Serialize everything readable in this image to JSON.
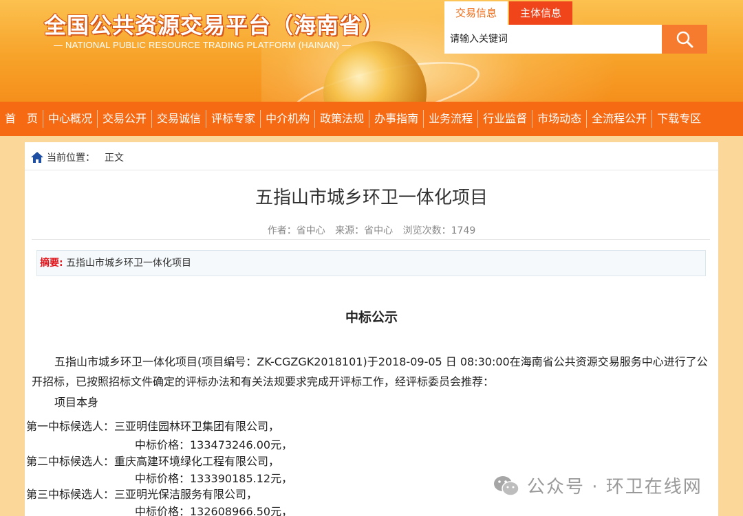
{
  "header": {
    "logo_title": "全国公共资源交易平台（海南省）",
    "logo_subtitle": "— NATIONAL PUBLIC RESOURCE TRADING PLATFORM (HAINAN) —",
    "search_tabs": [
      "交易信息",
      "主体信息"
    ],
    "search_placeholder": "请输入关键词"
  },
  "nav": {
    "items": [
      "首　页",
      "中心概况",
      "交易公开",
      "交易诚信",
      "评标专家",
      "中介机构",
      "政策法规",
      "办事指南",
      "业务流程",
      "行业监督",
      "市场动态",
      "全流程公开",
      "下载专区"
    ]
  },
  "breadcrumb": {
    "label": "当前位置：",
    "current": "正文"
  },
  "article": {
    "title": "五指山市城乡环卫一体化项目",
    "meta": {
      "author": "作者：省中心",
      "source": "来源：省中心",
      "views": "浏览次数：1749"
    },
    "summary_label": "摘要:",
    "summary_text": "五指山市城乡环卫一体化项目",
    "notice_heading": "中标公示",
    "paragraph": "五指山市城乡环卫一体化项目(项目编号：ZK-CGZGK2018101)于2018-09-05 日 08:30:00在海南省公共资源交易服务中心进行了公开招标，已按照招标文件确定的评标办法和有关法规要求完成开评标工作，经评标委员会推荐：",
    "section": "项目本身",
    "candidates": [
      {
        "label": "第一中标候选人：",
        "name": "三亚明佳园林环卫集团有限公司，",
        "price": "中标价格：133473246.00元，"
      },
      {
        "label": "第二中标候选人：",
        "name": "重庆高建环境绿化工程有限公司，",
        "price": "中标价格：133390185.12元，"
      },
      {
        "label": "第三中标候选人：",
        "name": "三亚明光保洁服务有限公司，",
        "price": "中标价格：132608966.50元，"
      }
    ]
  },
  "watermark": {
    "text": "公众号 · 环卫在线网"
  },
  "colors": {
    "nav_bg": "#f66a14",
    "header_orange": "#f7a32a",
    "search_btn": "#f77b2e",
    "summary_label": "#e0141a"
  }
}
